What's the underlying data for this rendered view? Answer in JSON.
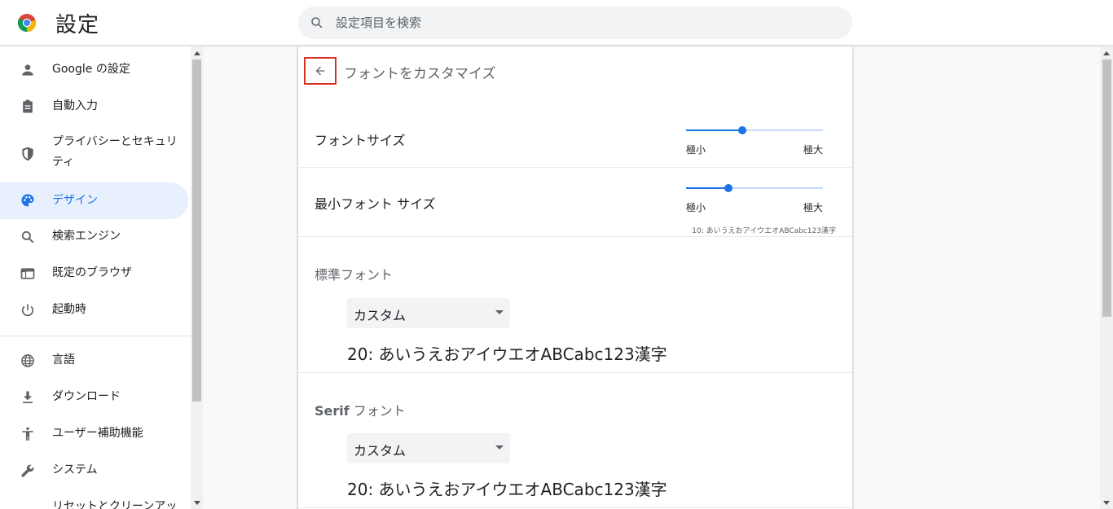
{
  "header": {
    "title": "設定",
    "search_placeholder": "設定項目を検索"
  },
  "sidebar": {
    "items": [
      {
        "label": "Google の設定",
        "icon": "person-icon"
      },
      {
        "label": "自動入力",
        "icon": "clipboard-icon"
      },
      {
        "label": "プライバシーとセキュリ",
        "label2": "ティ",
        "icon": "shield-icon"
      },
      {
        "label": "デザイン",
        "icon": "palette-icon",
        "active": true
      },
      {
        "label": "検索エンジン",
        "icon": "search-icon"
      },
      {
        "label": "既定のブラウザ",
        "icon": "browser-icon"
      },
      {
        "label": "起動時",
        "icon": "power-icon"
      },
      {
        "label": "言語",
        "icon": "globe-icon"
      },
      {
        "label": "ダウンロード",
        "icon": "download-icon"
      },
      {
        "label": "ユーザー補助機能",
        "icon": "accessibility-icon"
      },
      {
        "label": "システム",
        "icon": "wrench-icon"
      },
      {
        "label": "リセットとクリーンアッ",
        "icon": ""
      }
    ]
  },
  "page": {
    "subtitle": "フォントをカスタマイズ",
    "font_size": {
      "label": "フォントサイズ",
      "min_label": "極小",
      "max_label": "極大",
      "level": 0.41
    },
    "min_font_size": {
      "label": "最小フォント サイズ",
      "min_label": "極小",
      "max_label": "極大",
      "level": 0.31,
      "sample": "10: あいうえおアイウエオABCabc123漢字"
    },
    "standard_font": {
      "label": "標準フォント",
      "value": "カスタム",
      "sample": "20: あいうえおアイウエオABCabc123漢字"
    },
    "serif_font": {
      "label_bold": "Serif",
      "label": " フォント",
      "value": "カスタム",
      "sample": "20: あいうえおアイウエオABCabc123漢字"
    }
  },
  "colors": {
    "accent": "#1a73e8",
    "active_bg": "#e8f0fe",
    "highlight_border": "#d93025"
  }
}
